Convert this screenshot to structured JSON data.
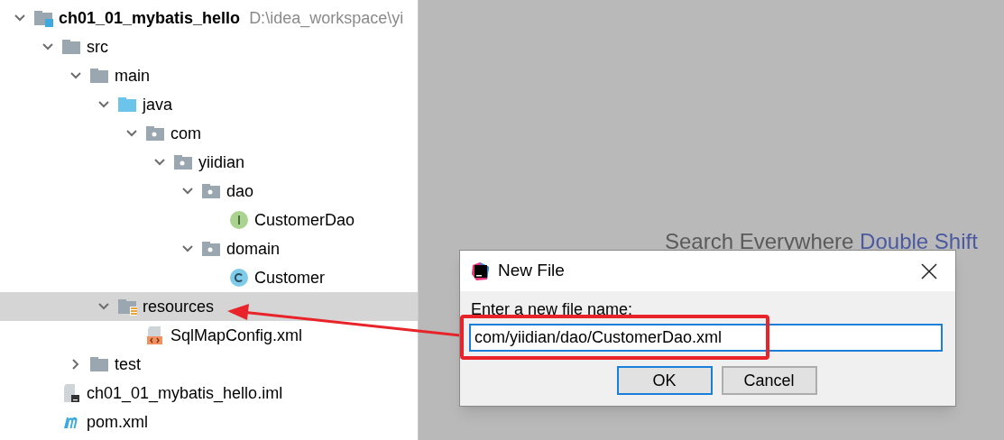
{
  "project_tree": [
    {
      "kind": "module",
      "label": "ch01_01_mybatis_hello",
      "path": "D:\\idea_workspace\\yi",
      "expanded": true,
      "selected": false,
      "children": [
        {
          "kind": "folder",
          "label": "src",
          "expanded": true,
          "selected": false,
          "children": [
            {
              "kind": "folder",
              "label": "main",
              "expanded": true,
              "selected": false,
              "children": [
                {
                  "kind": "source-root",
                  "label": "java",
                  "expanded": true,
                  "selected": false,
                  "children": [
                    {
                      "kind": "package",
                      "label": "com",
                      "expanded": true,
                      "selected": false,
                      "children": [
                        {
                          "kind": "package",
                          "label": "yiidian",
                          "expanded": true,
                          "selected": false,
                          "children": [
                            {
                              "kind": "package",
                              "label": "dao",
                              "expanded": true,
                              "selected": false,
                              "children": [
                                {
                                  "kind": "interface",
                                  "label": "CustomerDao",
                                  "selected": false
                                }
                              ]
                            },
                            {
                              "kind": "package",
                              "label": "domain",
                              "expanded": true,
                              "selected": false,
                              "children": [
                                {
                                  "kind": "class",
                                  "label": "Customer",
                                  "selected": false
                                }
                              ]
                            }
                          ]
                        }
                      ]
                    }
                  ]
                },
                {
                  "kind": "resources-root",
                  "label": "resources",
                  "expanded": true,
                  "selected": true,
                  "children": [
                    {
                      "kind": "xml",
                      "label": "SqlMapConfig.xml",
                      "selected": false
                    }
                  ]
                }
              ]
            },
            {
              "kind": "folder",
              "label": "test",
              "expanded": false,
              "selected": false
            }
          ]
        },
        {
          "kind": "iml",
          "label": "ch01_01_mybatis_hello.iml",
          "selected": false
        },
        {
          "kind": "maven",
          "label": "pom.xml",
          "selected": false
        }
      ]
    }
  ],
  "editor_hint": {
    "action": "Search Everywhere",
    "shortcut": "Double Shift"
  },
  "dialog": {
    "title": "New File",
    "prompt": "Enter a new file name:",
    "value": "com/yiidian/dao/CustomerDao.xml",
    "buttons": [
      {
        "label": "OK",
        "default": true
      },
      {
        "label": "Cancel",
        "default": false
      }
    ]
  }
}
